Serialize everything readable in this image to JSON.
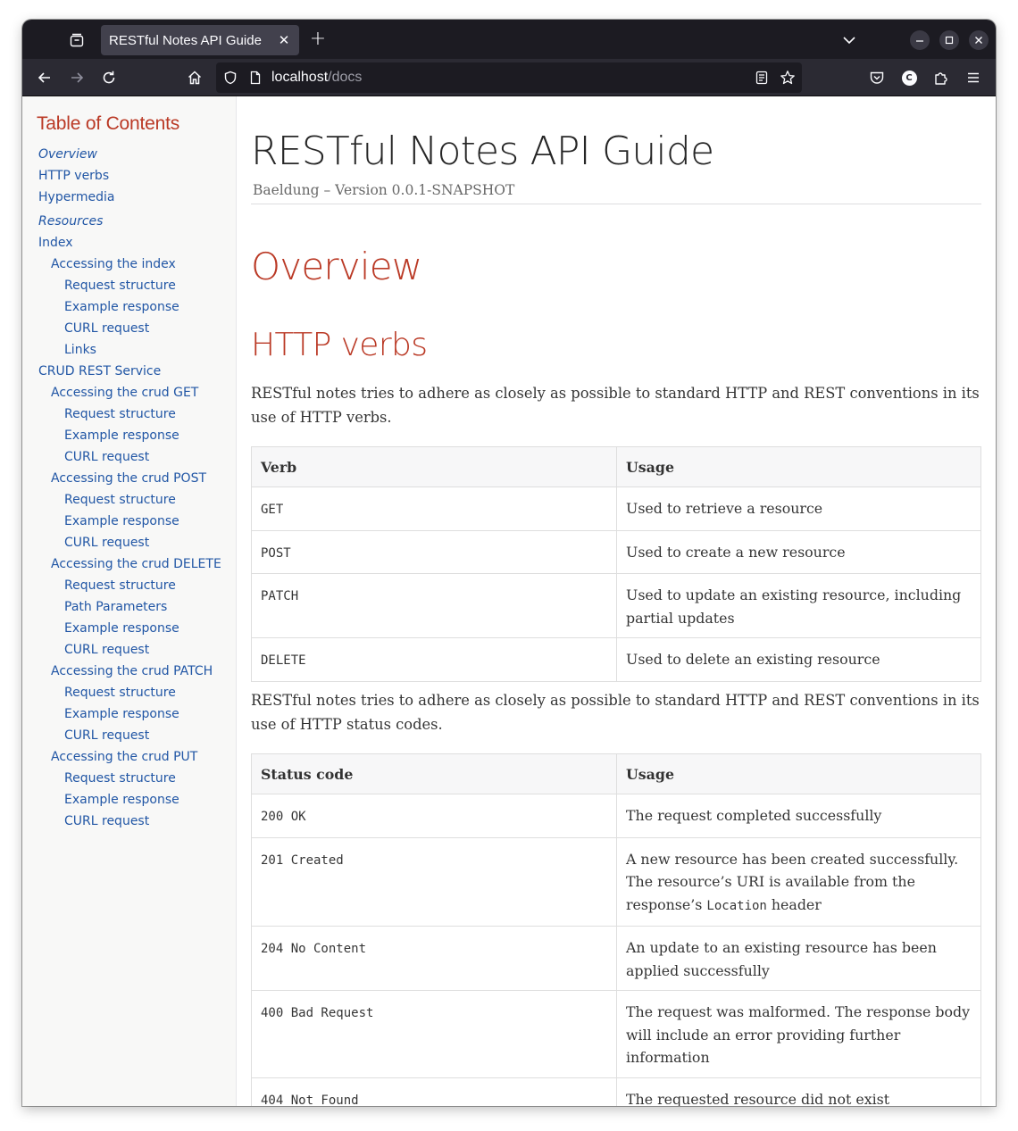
{
  "browser": {
    "tab_title": "RESTful Notes API Guide",
    "url_host": "localhost",
    "url_path": "/docs",
    "profile_initial": "C"
  },
  "toc": {
    "title": "Table of Contents",
    "items": [
      {
        "label": "Overview",
        "level": 1,
        "italic": true
      },
      {
        "label": "HTTP verbs",
        "level": 1,
        "italic": false
      },
      {
        "label": "Hypermedia",
        "level": 1,
        "italic": false
      },
      {
        "label": "Resources",
        "level": 1,
        "italic": true
      },
      {
        "label": "Index",
        "level": 1,
        "italic": false
      },
      {
        "label": "Accessing the index",
        "level": 2,
        "italic": false
      },
      {
        "label": "Request structure",
        "level": 3,
        "italic": false
      },
      {
        "label": "Example response",
        "level": 3,
        "italic": false
      },
      {
        "label": "CURL request",
        "level": 3,
        "italic": false
      },
      {
        "label": "Links",
        "level": 3,
        "italic": false
      },
      {
        "label": "CRUD REST Service",
        "level": 1,
        "italic": false
      },
      {
        "label": "Accessing the crud GET",
        "level": 2,
        "italic": false
      },
      {
        "label": "Request structure",
        "level": 3,
        "italic": false
      },
      {
        "label": "Example response",
        "level": 3,
        "italic": false
      },
      {
        "label": "CURL request",
        "level": 3,
        "italic": false
      },
      {
        "label": "Accessing the crud POST",
        "level": 2,
        "italic": false
      },
      {
        "label": "Request structure",
        "level": 3,
        "italic": false
      },
      {
        "label": "Example response",
        "level": 3,
        "italic": false
      },
      {
        "label": "CURL request",
        "level": 3,
        "italic": false
      },
      {
        "label": "Accessing the crud DELETE",
        "level": 2,
        "italic": false
      },
      {
        "label": "Request structure",
        "level": 3,
        "italic": false
      },
      {
        "label": "Path Parameters",
        "level": 3,
        "italic": false
      },
      {
        "label": "Example response",
        "level": 3,
        "italic": false
      },
      {
        "label": "CURL request",
        "level": 3,
        "italic": false
      },
      {
        "label": "Accessing the crud PATCH",
        "level": 2,
        "italic": false
      },
      {
        "label": "Request structure",
        "level": 3,
        "italic": false
      },
      {
        "label": "Example response",
        "level": 3,
        "italic": false
      },
      {
        "label": "CURL request",
        "level": 3,
        "italic": false
      },
      {
        "label": "Accessing the crud PUT",
        "level": 2,
        "italic": false
      },
      {
        "label": "Request structure",
        "level": 3,
        "italic": false
      },
      {
        "label": "Example response",
        "level": 3,
        "italic": false
      },
      {
        "label": "CURL request",
        "level": 3,
        "italic": false
      }
    ]
  },
  "doc": {
    "title": "RESTful Notes API Guide",
    "details": "Baeldung – Version 0.0.1-SNAPSHOT",
    "overview_heading": "Overview",
    "verbs_heading": "HTTP verbs",
    "verbs_intro": "RESTful notes tries to adhere as closely as possible to standard HTTP and REST conventions in its use of HTTP verbs.",
    "status_intro": "RESTful notes tries to adhere as closely as possible to standard HTTP and REST conventions in its use of HTTP status codes."
  },
  "verbs_table": {
    "headers": [
      "Verb",
      "Usage"
    ],
    "rows": [
      [
        "GET",
        "Used to retrieve a resource"
      ],
      [
        "POST",
        "Used to create a new resource"
      ],
      [
        "PATCH",
        "Used to update an existing resource, including partial updates"
      ],
      [
        "DELETE",
        "Used to delete an existing resource"
      ]
    ]
  },
  "status_table": {
    "headers": [
      "Status code",
      "Usage"
    ],
    "rows": [
      {
        "code": "200 OK",
        "usage": "The request completed successfully"
      },
      {
        "code": "201 Created",
        "usage_before": "A new resource has been created successfully. The resource’s URI is available from the response’s ",
        "usage_code": "Location",
        "usage_after": " header"
      },
      {
        "code": "204 No Content",
        "usage": "An update to an existing resource has been applied successfully"
      },
      {
        "code": "400 Bad Request",
        "usage": "The request was malformed. The response body will include an error providing further information"
      },
      {
        "code": "404 Not Found",
        "usage": "The requested resource did not exist"
      }
    ]
  },
  "colors": {
    "heading": "#ba3925",
    "link": "#2156a5",
    "toc_bg": "#f8f8f7",
    "chrome_tabstrip": "#1c1b22",
    "chrome_nav": "#2b2a33"
  }
}
